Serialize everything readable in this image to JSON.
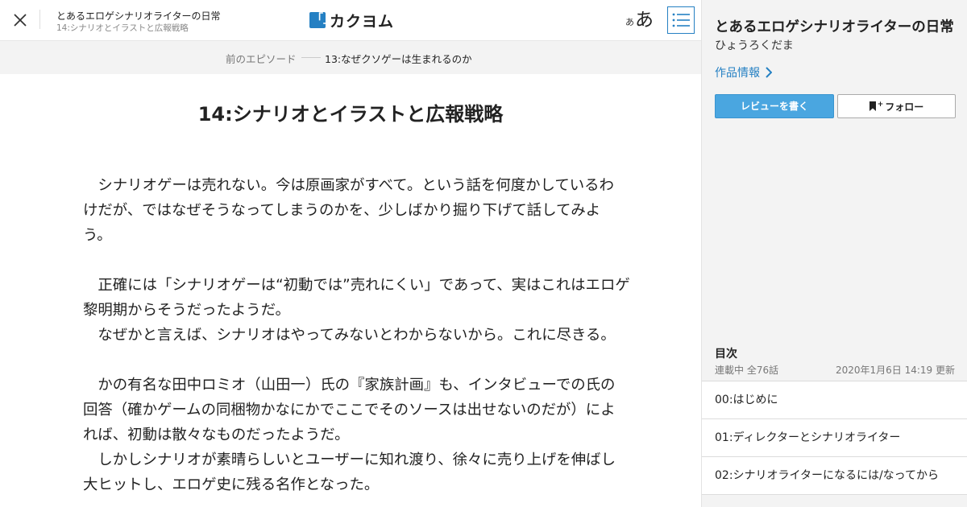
{
  "header": {
    "work_title": "とあるエロゲシナリオライターの日常",
    "episode_subtitle": "14:シナリオとイラストと広報戦略",
    "logo_text": "カクヨム",
    "logo_mark": "「」",
    "font_size_small": "あ",
    "font_size_big": "あ"
  },
  "prev_episode": {
    "label": "前のエピソード",
    "title": "13:なぜクソゲーは生まれるのか"
  },
  "episode": {
    "title": "14:シナリオとイラストと広報戦略",
    "lines": [
      "　シナリオゲーは売れない。今は原画家がすべて。という話を何度かしているわ",
      "けだが、ではなぜそうなってしまうのかを、少しばかり掘り下げて話してみよ",
      "う。",
      "",
      "　正確には「シナリオゲーは“初動では”売れにくい」であって、実はこれはエロゲ",
      "黎明期からそうだったようだ。",
      "　なぜかと言えば、シナリオはやってみないとわからないから。これに尽きる。",
      "",
      "　かの有名な田中ロミオ（山田一）氏の『家族計画』も、インタビューでの氏の",
      "回答（確かゲームの同梱物かなにかでここでそのソースは出せないのだが）によ",
      "れば、初動は散々なものだったようだ。",
      "　しかしシナリオが素晴らしいとユーザーに知れ渡り、徐々に売り上げを伸ばし",
      "大ヒットし、エロゲ史に残る名作となった。"
    ]
  },
  "sidebar": {
    "title": "とあるエロゲシナリオライターの日常",
    "author": "ひょうろくだま",
    "info_link": "作品情報",
    "review_button": "レビューを書く",
    "follow_button": "フォロー",
    "follow_plus": "+",
    "toc": {
      "heading": "目次",
      "status": "連載中 全76話",
      "updated": "2020年1月6日 14:19 更新",
      "items": [
        "00:はじめに",
        "01:ディレクターとシナリオライター",
        "02:シナリオライターになるには/なってから"
      ]
    }
  },
  "colors": {
    "accent": "#2580c3",
    "review_button": "#4aa6e0",
    "sidebar_bg": "#f3f3f3"
  }
}
